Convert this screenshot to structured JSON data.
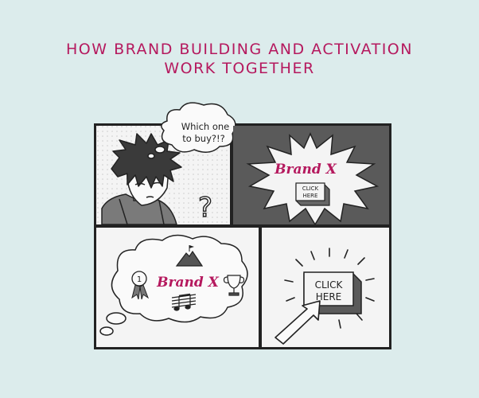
{
  "title": {
    "line1": "HOW BRAND BUILDING AND ACTIVATION",
    "line2": "WORK TOGETHER"
  },
  "panel1": {
    "thought_line1": "Which one",
    "thought_line2": "to buy?!?",
    "question_mark": "?"
  },
  "panel2": {
    "brand": "Brand X",
    "button_line1": "CLICK",
    "button_line2": "HERE"
  },
  "panel3": {
    "brand": "Brand X",
    "rosette_label": "1",
    "icons": [
      "mountain-icon",
      "rosette-icon",
      "trophy-icon",
      "music-icon"
    ]
  },
  "panel4": {
    "button_line1": "CLICK",
    "button_line2": "HERE"
  },
  "colors": {
    "background": "#dcecec",
    "accent": "#b5195e",
    "panel_dark": "#5a5a5a",
    "panel_light": "#f4f4f4"
  }
}
